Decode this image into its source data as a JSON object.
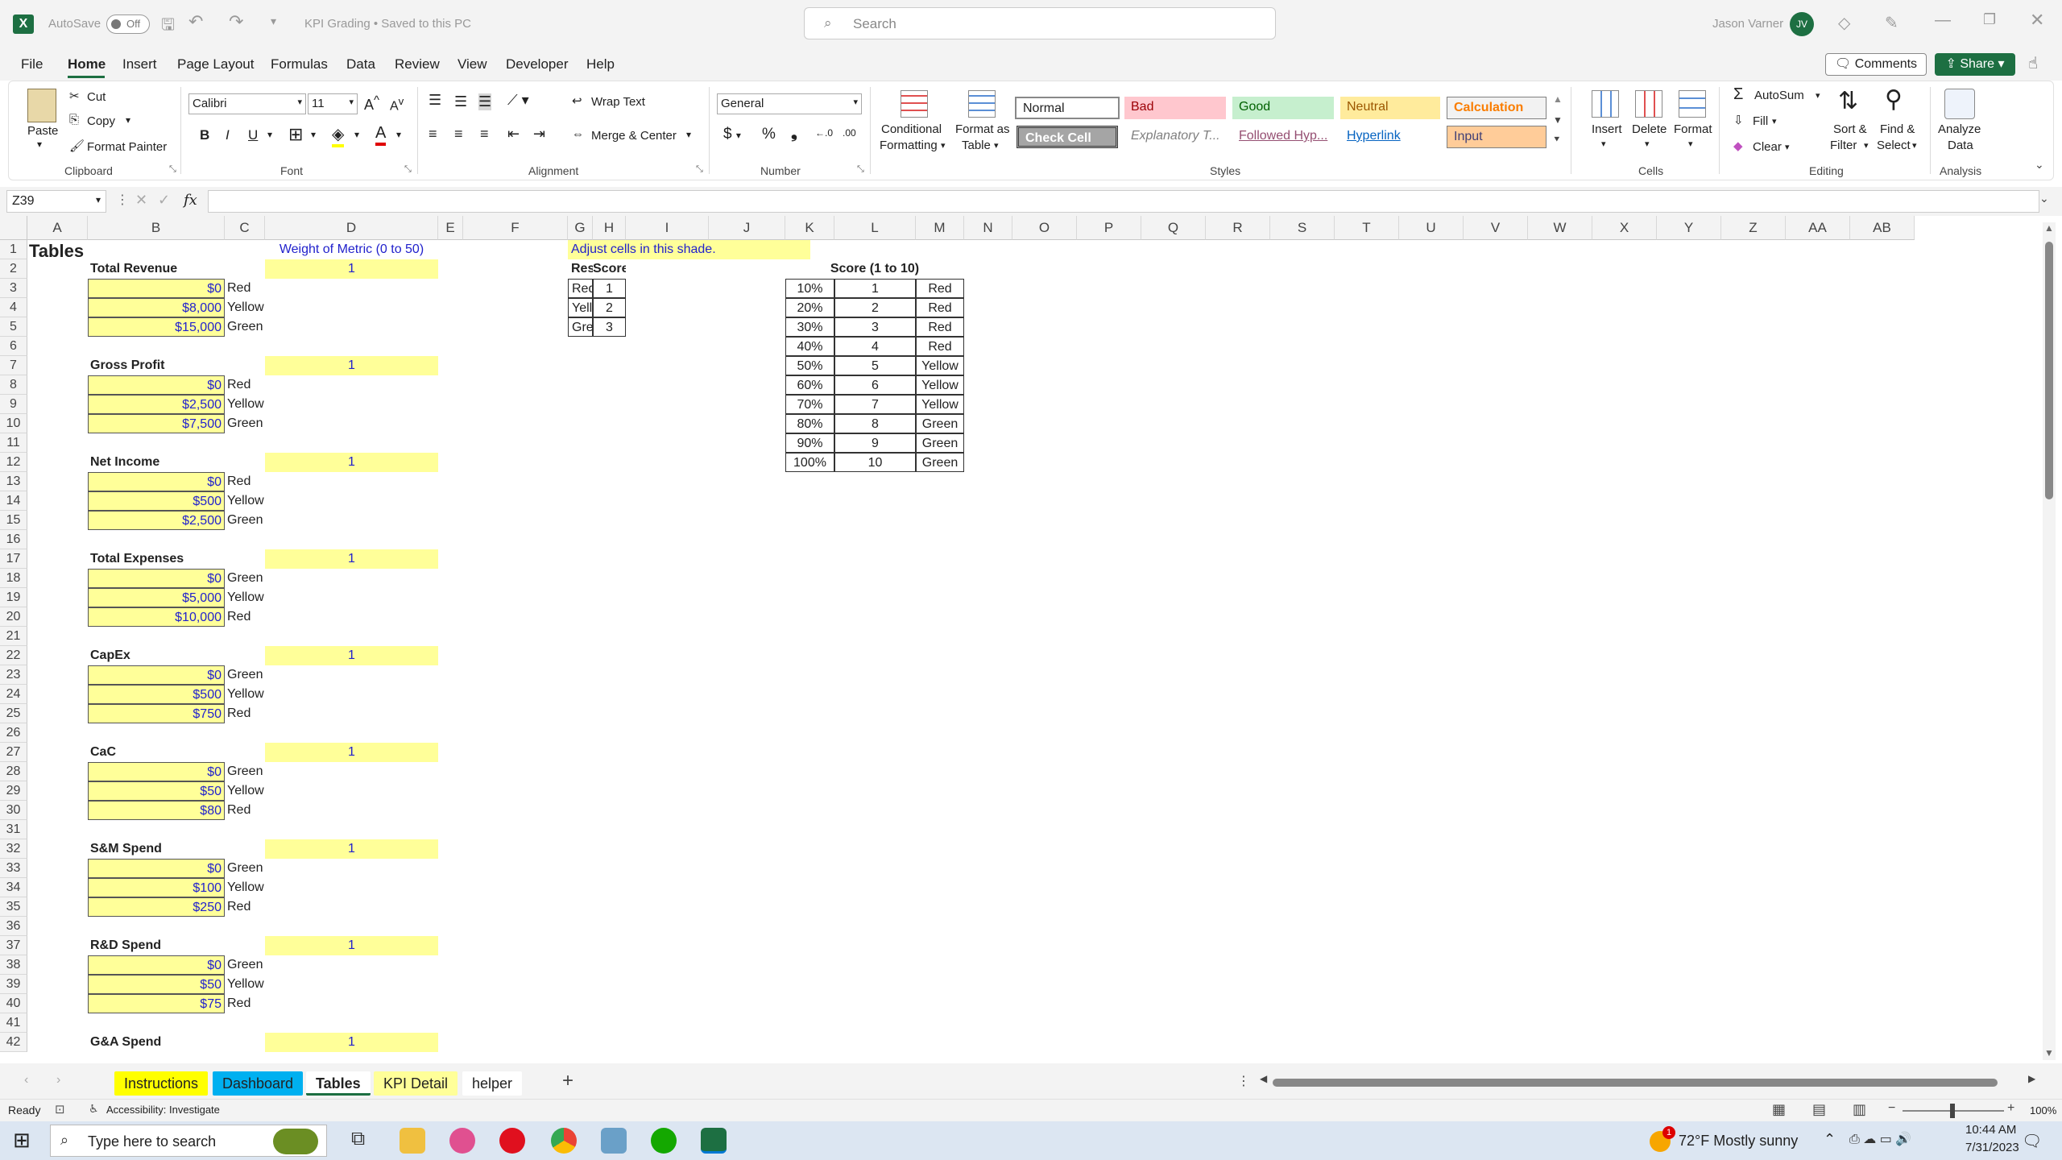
{
  "app": {
    "autosave_label": "AutoSave",
    "autosave_state": "Off",
    "doc_title": "KPI Grading • Saved to this PC",
    "search_placeholder": "Search",
    "user_name": "Jason Varner",
    "user_initials": "JV"
  },
  "menu": [
    "File",
    "Home",
    "Insert",
    "Page Layout",
    "Formulas",
    "Data",
    "Review",
    "View",
    "Developer",
    "Help"
  ],
  "menu_right": {
    "comments": "Comments",
    "share": "Share"
  },
  "ribbon": {
    "clipboard": {
      "paste": "Paste",
      "cut": "Cut",
      "copy": "Copy",
      "format_painter": "Format Painter",
      "group": "Clipboard"
    },
    "font": {
      "name": "Calibri",
      "size": "11",
      "group": "Font",
      "bold": "B",
      "italic": "I",
      "underline": "U"
    },
    "alignment": {
      "wrap": "Wrap Text",
      "merge": "Merge & Center",
      "group": "Alignment"
    },
    "number": {
      "format": "General",
      "group": "Number"
    },
    "styles": {
      "cond": [
        "Conditional",
        "Formatting"
      ],
      "fmt_table": [
        "Format as",
        "Table"
      ],
      "group": "Styles",
      "cells": [
        "Normal",
        "Bad",
        "Good",
        "Neutral",
        "Calculation",
        "Check Cell",
        "Explanatory T...",
        "Followed Hyp...",
        "Hyperlink",
        "Input"
      ]
    },
    "cells": {
      "insert": "Insert",
      "delete": "Delete",
      "format": "Format",
      "group": "Cells"
    },
    "editing": {
      "autosum": "AutoSum",
      "fill": "Fill",
      "clear": "Clear",
      "sort": [
        "Sort &",
        "Filter"
      ],
      "find": [
        "Find &",
        "Select"
      ],
      "group": "Editing"
    },
    "analysis": {
      "analyze": [
        "Analyze",
        "Data"
      ],
      "group": "Analysis"
    }
  },
  "formula": {
    "namebox": "Z39",
    "fx": "fx",
    "value": ""
  },
  "columns": [
    "A",
    "B",
    "C",
    "D",
    "E",
    "F",
    "G",
    "H",
    "I",
    "J",
    "K",
    "L",
    "M",
    "N",
    "O",
    "P",
    "Q",
    "R",
    "S",
    "T",
    "U",
    "V",
    "W",
    "X",
    "Y",
    "Z",
    "AA",
    "AB"
  ],
  "rows": [
    "1",
    "2",
    "3",
    "4",
    "5",
    "6",
    "7",
    "8",
    "9",
    "10",
    "11",
    "12",
    "13",
    "14",
    "15",
    "16",
    "17",
    "18",
    "19",
    "20",
    "21",
    "22",
    "23",
    "24",
    "25",
    "26",
    "27",
    "28",
    "29",
    "30",
    "31",
    "32",
    "33",
    "34",
    "35",
    "36",
    "37",
    "38",
    "39",
    "40",
    "41",
    "42"
  ],
  "sheet": {
    "title": "Tables",
    "weight_header": "Weight of Metric (0 to 50)",
    "adjust_note": "Adjust cells in this shade.",
    "metrics": [
      {
        "name": "Total Revenue",
        "weight": "1",
        "vals": [
          "$0",
          "$8,000",
          "$15,000"
        ],
        "labels": [
          "Red",
          "Yellow",
          "Green"
        ]
      },
      {
        "name": "Gross Profit",
        "weight": "1",
        "vals": [
          "$0",
          "$2,500",
          "$7,500"
        ],
        "labels": [
          "Red",
          "Yellow",
          "Green"
        ]
      },
      {
        "name": "Net Income",
        "weight": "1",
        "vals": [
          "$0",
          "$500",
          "$2,500"
        ],
        "labels": [
          "Red",
          "Yellow",
          "Green"
        ]
      },
      {
        "name": "Total Expenses",
        "weight": "1",
        "vals": [
          "$0",
          "$5,000",
          "$10,000"
        ],
        "labels": [
          "Green",
          "Yellow",
          "Red"
        ]
      },
      {
        "name": "CapEx",
        "weight": "1",
        "vals": [
          "$0",
          "$500",
          "$750"
        ],
        "labels": [
          "Green",
          "Yellow",
          "Red"
        ]
      },
      {
        "name": "CaC",
        "weight": "1",
        "vals": [
          "$0",
          "$50",
          "$80"
        ],
        "labels": [
          "Green",
          "Yellow",
          "Red"
        ]
      },
      {
        "name": "S&M Spend",
        "weight": "1",
        "vals": [
          "$0",
          "$100",
          "$250"
        ],
        "labels": [
          "Green",
          "Yellow",
          "Red"
        ]
      },
      {
        "name": "R&D Spend",
        "weight": "1",
        "vals": [
          "$0",
          "$50",
          "$75"
        ],
        "labels": [
          "Green",
          "Yellow",
          "Red"
        ]
      },
      {
        "name": "G&A Spend",
        "weight": "1",
        "vals": [],
        "labels": []
      }
    ],
    "result_table": {
      "headers": [
        "Result",
        "Score"
      ],
      "rows": [
        [
          "Red",
          "1"
        ],
        [
          "Yellow",
          "2"
        ],
        [
          "Green",
          "3"
        ]
      ]
    },
    "score_table": {
      "title": "Score (1 to 10)",
      "rows": [
        [
          "10%",
          "1",
          "Red"
        ],
        [
          "20%",
          "2",
          "Red"
        ],
        [
          "30%",
          "3",
          "Red"
        ],
        [
          "40%",
          "4",
          "Red"
        ],
        [
          "50%",
          "5",
          "Yellow"
        ],
        [
          "60%",
          "6",
          "Yellow"
        ],
        [
          "70%",
          "7",
          "Yellow"
        ],
        [
          "80%",
          "8",
          "Green"
        ],
        [
          "90%",
          "9",
          "Green"
        ],
        [
          "100%",
          "10",
          "Green"
        ]
      ]
    }
  },
  "tabs": [
    "Instructions",
    "Dashboard",
    "Tables",
    "KPI Detail",
    "helper"
  ],
  "status": {
    "ready": "Ready",
    "accessibility": "Accessibility: Investigate",
    "zoom": "100%"
  },
  "taskbar": {
    "search_placeholder": "Type here to search",
    "weather": "72°F  Mostly sunny",
    "time": "10:44 AM",
    "date": "7/31/2023",
    "weather_badge": "1"
  },
  "colors": {
    "excel_green": "#1d6f42",
    "input_yellow": "#ffff99",
    "link_blue": "#2222cc",
    "dashboard_tab": "#00b0f0",
    "instructions_tab": "#ffff00",
    "kpi_tab": "#ffff99"
  }
}
